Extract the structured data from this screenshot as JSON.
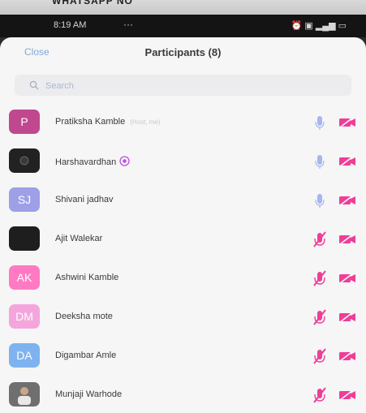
{
  "frame": {
    "partial_text": "WHATSAPP NO"
  },
  "status_bar": {
    "time": "8:19 AM",
    "overflow": "···",
    "icons": [
      "alarm-icon",
      "battery-saver-icon",
      "signal-icon",
      "battery-icon"
    ]
  },
  "header": {
    "close_label": "Close",
    "title": "Participants (8)"
  },
  "search": {
    "placeholder": "Search"
  },
  "participants": [
    {
      "name": "Pratiksha Kamble",
      "tag": "(Host, me)",
      "initials": "P",
      "avatar_color": "#c0488f",
      "mic": "on"
    },
    {
      "name": "Harshavardhan",
      "tag": "",
      "initials": "",
      "avatar_color": "#222222",
      "mic": "on",
      "verified": true
    },
    {
      "name": "Shivani jadhav",
      "tag": "",
      "initials": "SJ",
      "avatar_color": "#9da0e6",
      "mic": "on"
    },
    {
      "name": "Ajit Walekar",
      "tag": "",
      "initials": "",
      "avatar_color": "#1e1e1e",
      "mic": "muted"
    },
    {
      "name": "Ashwini Kamble",
      "tag": "",
      "initials": "AK",
      "avatar_color": "#ff7ac2",
      "mic": "muted"
    },
    {
      "name": "Deeksha mote",
      "tag": "",
      "initials": "DM",
      "avatar_color": "#f4a6dc",
      "mic": "muted"
    },
    {
      "name": "Digambar Amle",
      "tag": "",
      "initials": "DA",
      "avatar_color": "#7eb3ef",
      "mic": "muted"
    },
    {
      "name": "Munjaji Warhode",
      "tag": "",
      "initials": "",
      "avatar_color": "#6f6f6f",
      "mic": "muted"
    }
  ],
  "colors": {
    "mic_on": "#a6b6f0",
    "muted": "#ee3e98",
    "camera_off": "#ee3e98",
    "link": "#7fa8d8"
  }
}
